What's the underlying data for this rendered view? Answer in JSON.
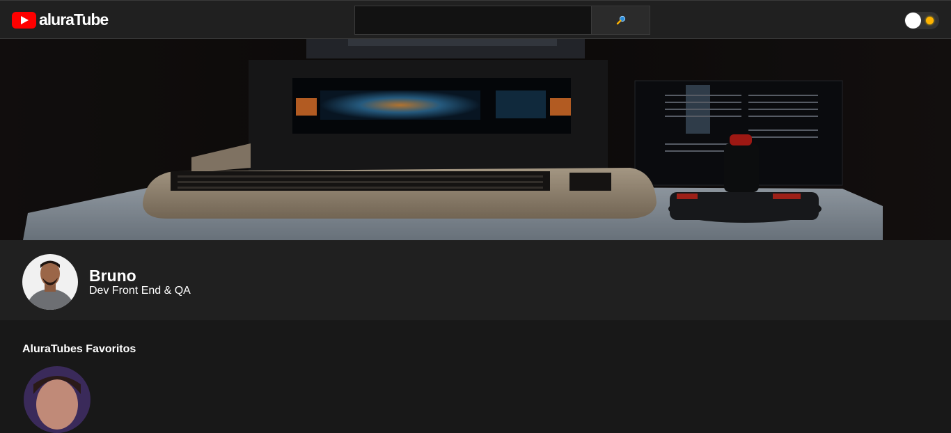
{
  "header": {
    "logo_text_bold": "alura",
    "logo_text_rest": "Tube",
    "search": {
      "value": "",
      "placeholder": ""
    },
    "search_button_icon": "magnifier-icon",
    "theme_toggle": {
      "state": "dark"
    }
  },
  "banner": {
    "image": "commodore-64-computer-photo"
  },
  "profile": {
    "name": "Bruno",
    "description": "Dev Front End & QA"
  },
  "favorites": {
    "title": "AluraTubes Favoritos"
  },
  "colors": {
    "brand_red": "#ff0000",
    "topbar_bg": "#202020",
    "page_bg": "#181818",
    "toggle_sun": "#ffb300"
  }
}
